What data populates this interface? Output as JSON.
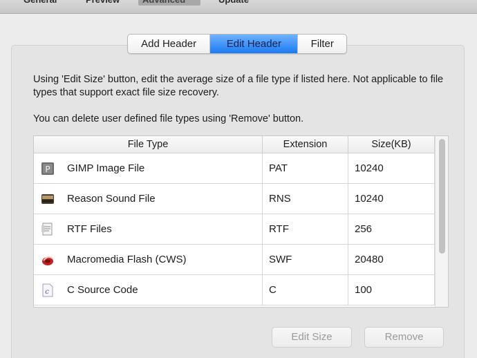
{
  "toolbar": {
    "items": [
      "General",
      "Preview",
      "Advanced",
      "Update"
    ],
    "active": "Advanced"
  },
  "tabs": [
    {
      "label": "Add Header",
      "active": false
    },
    {
      "label": "Edit Header",
      "active": true
    },
    {
      "label": "Filter",
      "active": false
    }
  ],
  "description": {
    "line1": "Using 'Edit Size' button, edit the average size of a file type if listed here. Not applicable to file types that support exact file size recovery.",
    "line2": "You can delete user defined file types using 'Remove' button."
  },
  "table": {
    "columns": [
      "File Type",
      "Extension",
      "Size(KB)"
    ],
    "rows": [
      {
        "icon": "gimp-file-icon",
        "file_type": "GIMP Image File",
        "extension": "PAT",
        "size": "10240"
      },
      {
        "icon": "reason-sound-icon",
        "file_type": "Reason Sound File",
        "extension": "RNS",
        "size": "10240"
      },
      {
        "icon": "rtf-file-icon",
        "file_type": "RTF Files",
        "extension": "RTF",
        "size": "256"
      },
      {
        "icon": "flash-file-icon",
        "file_type": "Macromedia Flash (CWS)",
        "extension": "SWF",
        "size": "20480"
      },
      {
        "icon": "c-source-icon",
        "file_type": "C Source Code",
        "extension": "C",
        "size": "100"
      }
    ]
  },
  "buttons": {
    "edit_size": "Edit Size",
    "remove": "Remove"
  },
  "colors": {
    "active_tab": "#1b7af0",
    "panel_bg": "#e4e4e4",
    "disabled_text": "#9a9a9a"
  }
}
